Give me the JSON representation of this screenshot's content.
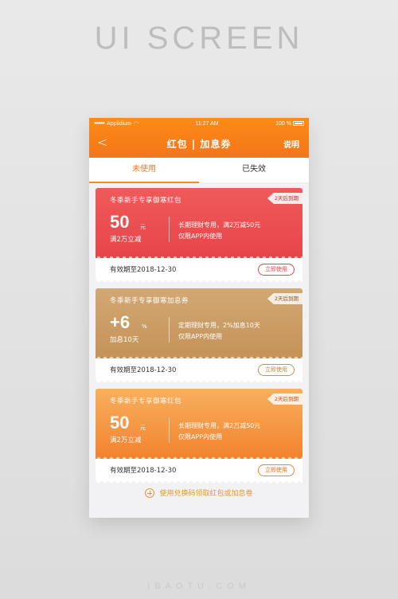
{
  "hero": {
    "title": "UI SCREEN"
  },
  "watermark": "IBAOTU.COM",
  "status_bar": {
    "carrier": "Applidium",
    "time": "11:27 AM",
    "battery": "100 %"
  },
  "nav": {
    "back_icon": "back-chevron-icon",
    "title": "红包 | 加息券",
    "help_label": "说明"
  },
  "tabs": [
    {
      "label": "未使用",
      "active": true
    },
    {
      "label": "已失效",
      "active": false
    }
  ],
  "coupons": [
    {
      "title": "冬季新手专享御寒红包",
      "expire_tag": "2天后到期",
      "value": "50",
      "unit": "元",
      "condition": "满2万立减",
      "desc_line1": "长期理财专用，满2万减50元",
      "desc_line2": "仅限APP内使用",
      "validity": "有效期至2018-12-30",
      "button_label": "立即使用",
      "color": "#e6454a"
    },
    {
      "title": "冬季新手专享御寒加息券",
      "expire_tag": "2天后到期",
      "value": "+6",
      "unit": "%",
      "condition": "加息10天",
      "desc_line1": "定期理财专用，2%加息10天",
      "desc_line2": "仅限APP内使用",
      "validity": "有效期至2018-12-30",
      "button_label": "立即使用",
      "color": "#c59258"
    },
    {
      "title": "冬季新手专享御寒红包",
      "expire_tag": "2天后到期",
      "value": "50",
      "unit": "元",
      "condition": "满2万立减",
      "desc_line1": "长期理财专用，满2万减50元",
      "desc_line2": "仅限APP内使用",
      "validity": "有效期至2018-12-30",
      "button_label": "立即使用",
      "color": "#f2822e"
    }
  ],
  "footer": {
    "link_label": "使用兑换码领取红包或加息卷",
    "icon": "plus-circle-icon"
  }
}
